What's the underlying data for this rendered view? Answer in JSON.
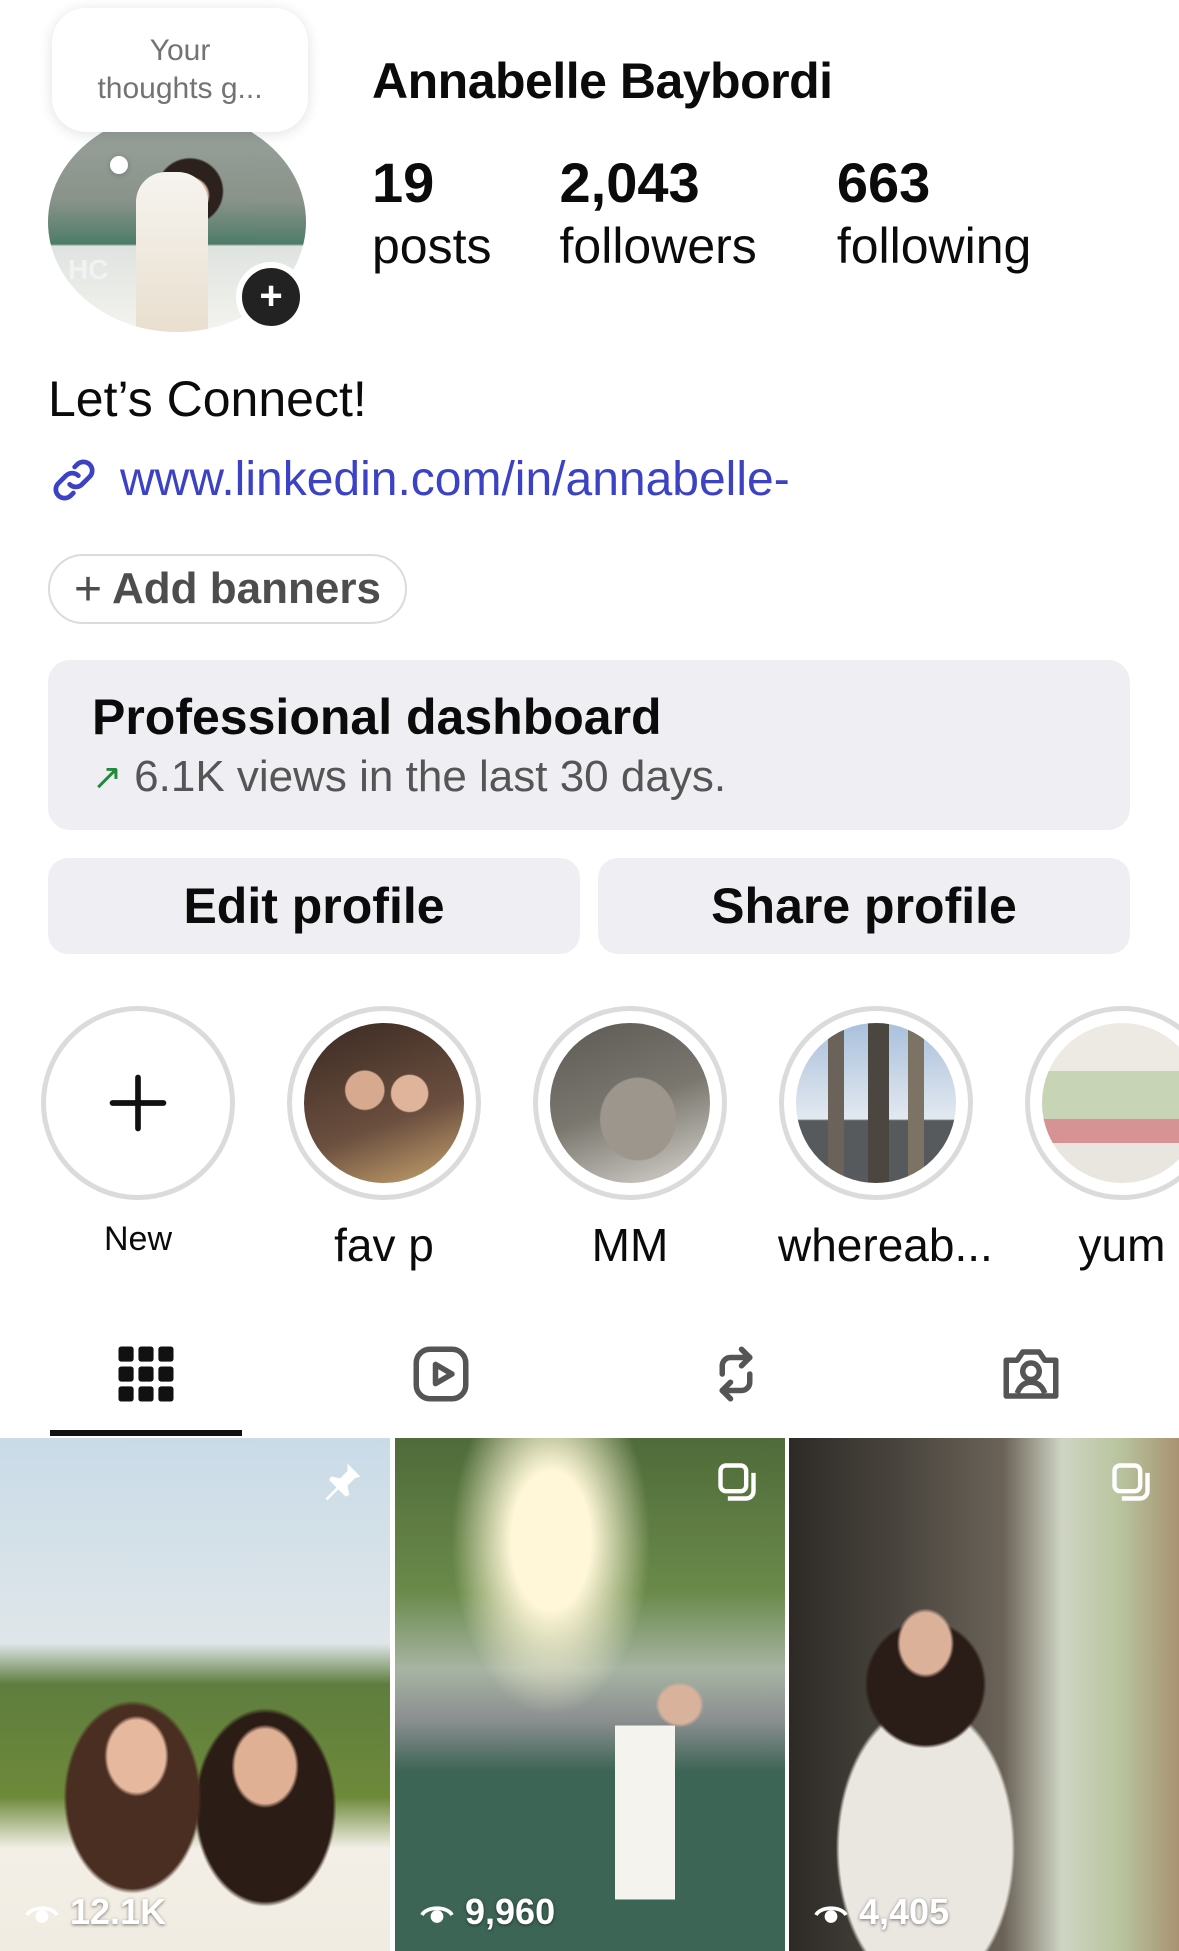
{
  "profile": {
    "thought_bubble": "Your thoughts g...",
    "name": "Annabelle Baybordi",
    "stats": {
      "posts_count": "19",
      "posts_label": "posts",
      "followers_count": "2,043",
      "followers_label": "followers",
      "following_count": "663",
      "following_label": "following"
    },
    "bio": "Let’s Connect!",
    "link": "www.linkedin.com/in/annabelle-",
    "add_banners": "Add banners"
  },
  "dashboard": {
    "title": "Professional dashboard",
    "subtitle": "6.1K views in the last 30 days."
  },
  "buttons": {
    "edit": "Edit profile",
    "share": "Share profile"
  },
  "highlights": [
    {
      "label": "New",
      "icon": "plus-icon"
    },
    {
      "label": "fav p",
      "color": "#6b4f3f"
    },
    {
      "label": "MM",
      "color": "#7a776f"
    },
    {
      "label": "whereab...",
      "color": "#8a9bb3"
    },
    {
      "label": "yum",
      "color": "#b9c1a8"
    }
  ],
  "tabs": [
    {
      "name": "grid-icon",
      "active": true
    },
    {
      "name": "reels-icon",
      "active": false
    },
    {
      "name": "reposts-icon",
      "active": false
    },
    {
      "name": "tagged-icon",
      "active": false
    }
  ],
  "posts": [
    {
      "views": "12.1K",
      "icon": "pin-icon"
    },
    {
      "views": "9,960",
      "icon": "carousel-icon"
    },
    {
      "views": "4,405",
      "icon": "carousel-icon"
    }
  ],
  "colors": {
    "link": "#3b42c4",
    "button_bg": "#efeff3",
    "trend_arrow": "#1f8a3a"
  }
}
